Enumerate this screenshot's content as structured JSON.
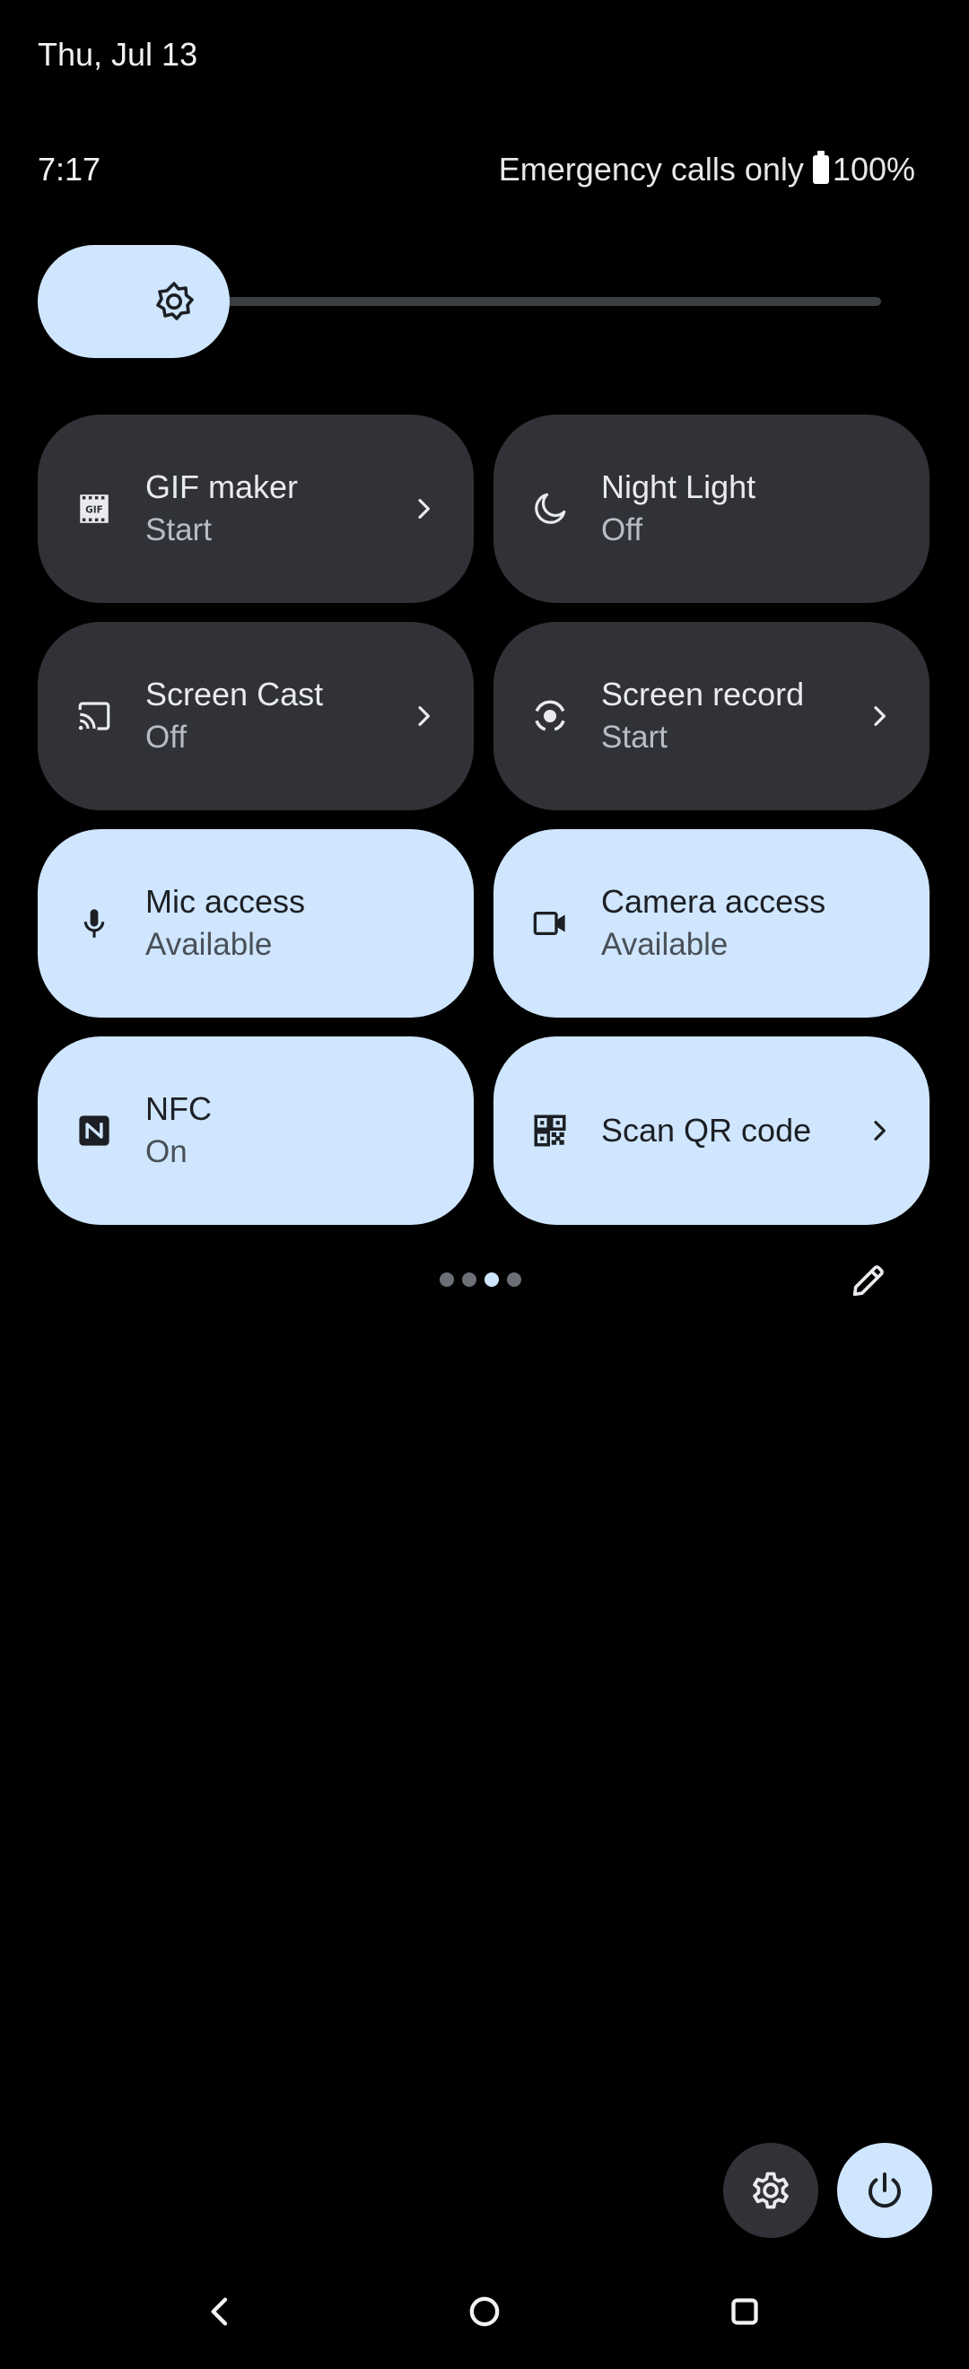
{
  "header": {
    "date": "Thu, Jul 13",
    "time": "7:17",
    "network_status": "Emergency calls only",
    "battery_percent": "100%"
  },
  "brightness": {
    "icon": "brightness-icon"
  },
  "tiles": [
    {
      "label": "GIF maker",
      "state": "Start",
      "icon": "gif-icon",
      "style": "dark",
      "has_chevron": true
    },
    {
      "label": "Night Light",
      "state": "Off",
      "icon": "moon-icon",
      "style": "dark",
      "has_chevron": false
    },
    {
      "label": "Screen Cast",
      "state": "Off",
      "icon": "cast-icon",
      "style": "dark",
      "has_chevron": true
    },
    {
      "label": "Screen record",
      "state": "Start",
      "icon": "screen-record-icon",
      "style": "dark",
      "has_chevron": true
    },
    {
      "label": "Mic access",
      "state": "Available",
      "icon": "mic-icon",
      "style": "light",
      "has_chevron": false
    },
    {
      "label": "Camera access",
      "state": "Available",
      "icon": "camera-icon",
      "style": "light",
      "has_chevron": false
    },
    {
      "label": "NFC",
      "state": "On",
      "icon": "nfc-icon",
      "style": "light",
      "has_chevron": false
    },
    {
      "label": "Scan QR code",
      "state": "",
      "icon": "qr-code-icon",
      "style": "light",
      "has_chevron": true
    }
  ],
  "pagination": {
    "pages": 4,
    "current": 3
  },
  "colors": {
    "accent": "#cfe6fe",
    "tile_dark": "#303237",
    "background": "#000000"
  }
}
